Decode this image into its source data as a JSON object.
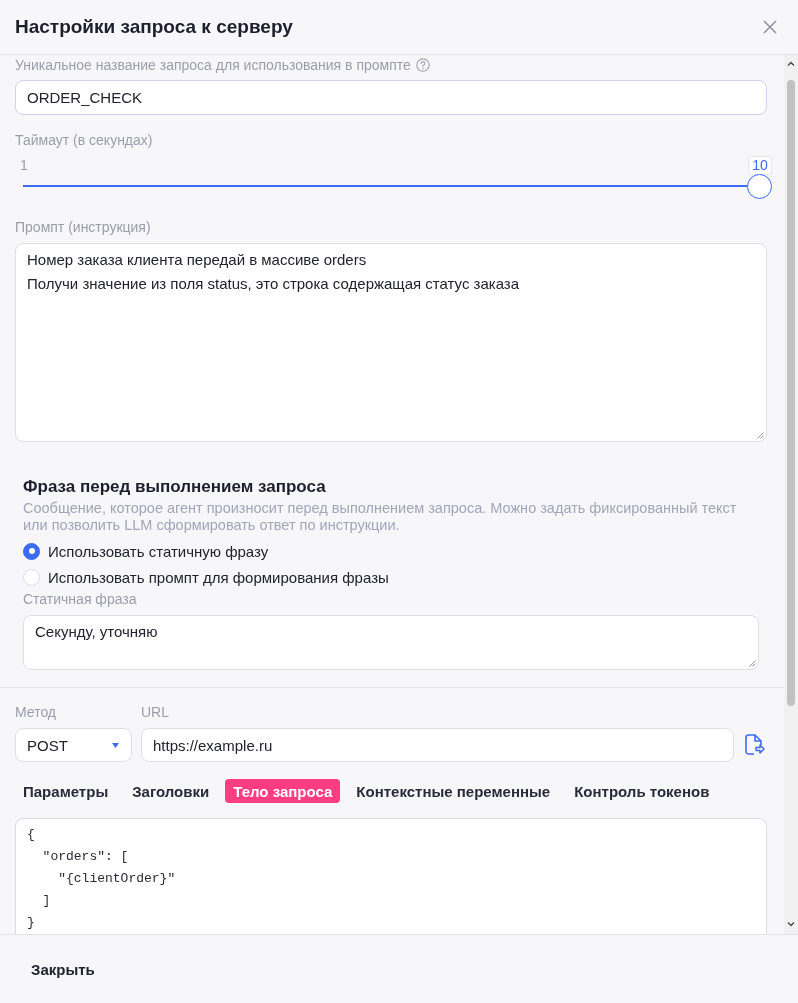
{
  "dialog": {
    "title": "Настройки запроса к серверу"
  },
  "name_field": {
    "label": "Уникальное название запроса для использования в промпте",
    "value": "ORDER_CHECK"
  },
  "timeout": {
    "label": "Таймаут (в секундах)",
    "min_label": "1",
    "value_label": "10",
    "level": 1
  },
  "prompt": {
    "label": "Промпт (инструкция)",
    "value": "Номер заказа клиента передай в массиве orders\nПолучи значение из поля status, это строка содержащая статус заказа"
  },
  "phrase": {
    "title": "Фраза перед выполнением запроса",
    "description": "Сообщение, которое агент произносит перед выполнением запроса. Можно задать фиксированный текст или позволить LLM сформировать ответ по инструкции.",
    "options": [
      {
        "label": "Использовать статичную фразу",
        "selected": true
      },
      {
        "label": "Использовать промпт для формирования фразы",
        "selected": false
      }
    ],
    "static_phrase": {
      "label": "Статичная фраза",
      "value": "Секунду, уточняю"
    }
  },
  "request": {
    "method": {
      "label": "Метод",
      "value": "POST"
    },
    "url": {
      "label": "URL",
      "value": "https://example.ru"
    }
  },
  "tabs": [
    {
      "label": "Параметры",
      "selected": false
    },
    {
      "label": "Заголовки",
      "selected": false
    },
    {
      "label": "Тело запроса",
      "selected": true
    },
    {
      "label": "Контекстные переменные",
      "selected": false
    },
    {
      "label": "Контроль токенов",
      "selected": false
    }
  ],
  "body_lines": [
    "{",
    "  \"orders\": [",
    "    \"{clientOrder}\"",
    "  ]",
    "}"
  ],
  "footer": {
    "buttons": [
      "Закрыть"
    ]
  }
}
